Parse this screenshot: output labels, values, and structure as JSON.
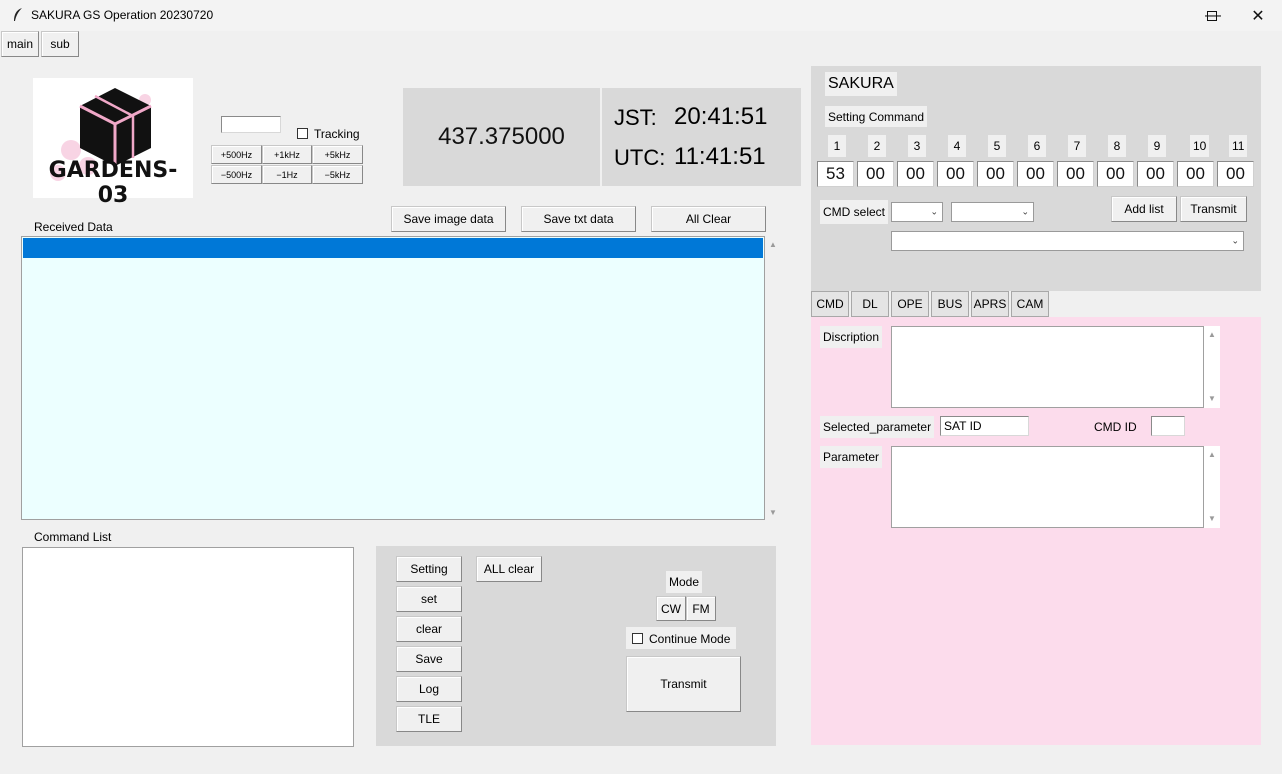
{
  "window": {
    "title": "SAKURA GS Operation 20230720",
    "minimize_icon": "minimize-icon",
    "maximize_icon": "maximize-icon",
    "close_icon": "close-icon"
  },
  "top_tabs": {
    "main": "main",
    "sub": "sub"
  },
  "logo": {
    "text": "GARDENS-03"
  },
  "freq": {
    "entry_value": "",
    "tracking_label": "Tracking",
    "buttons_up": [
      "+500Hz",
      "+1kHz",
      "+5kHz"
    ],
    "buttons_down": [
      "−500Hz",
      "−1Hz",
      "−5kHz"
    ],
    "display": "437.375000"
  },
  "clock": {
    "jst_label": "JST:",
    "jst_time": "20:41:51",
    "utc_label": "UTC:",
    "utc_time": "11:41:51"
  },
  "received": {
    "label": "Received Data",
    "save_image": "Save image data",
    "save_txt": "Save txt data",
    "all_clear": "All Clear"
  },
  "command_list": {
    "label": "Command List"
  },
  "control": {
    "buttons": [
      "Setting",
      "set",
      "clear",
      "Save",
      "Log",
      "TLE"
    ],
    "all_clear": "ALL clear",
    "mode_label": "Mode",
    "cw": "CW",
    "fm": "FM",
    "continue_label": "Continue Mode",
    "transmit": "Transmit"
  },
  "sakura": {
    "title": "SAKURA",
    "setting_command": "Setting Command",
    "indices": [
      "1",
      "2",
      "3",
      "4",
      "5",
      "6",
      "7",
      "8",
      "9",
      "10",
      "11"
    ],
    "values": [
      "53",
      "00",
      "00",
      "00",
      "00",
      "00",
      "00",
      "00",
      "00",
      "00",
      "00"
    ],
    "cmd_select": "CMD select",
    "add_list": "Add list",
    "transmit": "Transmit"
  },
  "tabs": [
    "CMD",
    "DL",
    "OPE",
    "BUS",
    "APRS",
    "CAM"
  ],
  "detail": {
    "description_label": "Discription",
    "selected_parameter_label": "Selected_parameter",
    "selected_parameter_value": "SAT ID",
    "cmd_id_label": "CMD ID",
    "cmd_id_value": "",
    "parameter_label": "Parameter"
  },
  "colors": {
    "selection": "#0078d7",
    "received_bg": "#ecffff",
    "gray_panel": "#d9d9d9",
    "pink_panel": "#fcdcec"
  }
}
